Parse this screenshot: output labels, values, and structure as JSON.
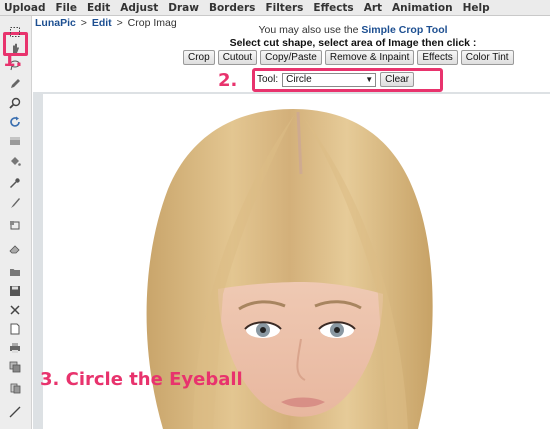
{
  "menu": [
    "Upload",
    "File",
    "Edit",
    "Adjust",
    "Draw",
    "Borders",
    "Filters",
    "Effects",
    "Art",
    "Animation",
    "Help"
  ],
  "breadcrumb": {
    "root": "LunaPic",
    "sep1": ">",
    "section": "Edit",
    "sep2": ">",
    "current": "Crop Imag"
  },
  "header": {
    "also_prefix": "You may also use the",
    "also_link": "Simple Crop Tool",
    "instruction": "Select cut shape, select area of Image then click :"
  },
  "buttons": [
    "Crop",
    "Cutout",
    "Copy/Paste",
    "Remove & Inpaint",
    "Effects",
    "Color Tint"
  ],
  "tool_select": {
    "label": "Tool:",
    "value": "Circle",
    "clear_label": "Clear"
  },
  "toolbar_icons": [
    "select-marquee-icon",
    "hand-icon",
    "lasso-icon",
    "zoom-icon",
    "rotate-icon",
    "layers-icon",
    "paint-bucket-icon",
    "eyedropper-icon",
    "brush-icon",
    "crop-icon",
    "eraser-icon",
    "open-icon",
    "save-icon",
    "close-icon",
    "new-page-icon",
    "print-icon",
    "duplicate-icon",
    "copy-icon",
    "line-icon"
  ],
  "annotations": {
    "step1": "1.",
    "step2": "2.",
    "step3": "3. Circle the Eyeball"
  },
  "colors": {
    "annotation": "#e8336d",
    "link": "#1d4f91",
    "canvas_bg": "#dde1e4"
  }
}
